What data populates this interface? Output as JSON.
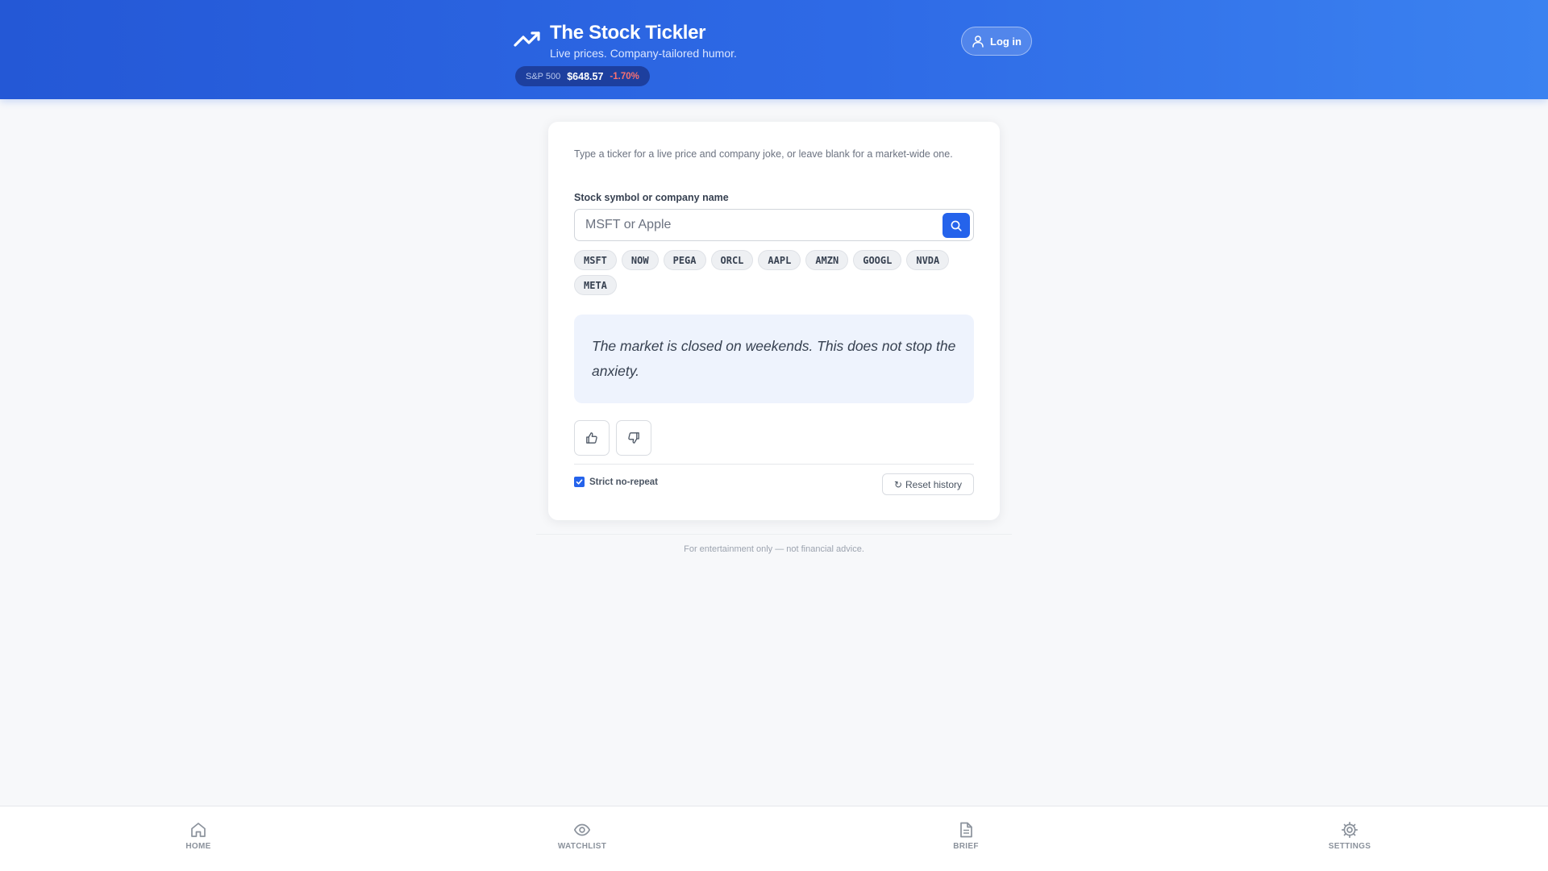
{
  "header": {
    "title": "The Stock Tickler",
    "subtitle": "Live prices. Company-tailored humor.",
    "index": {
      "name": "S&P 500",
      "price": "$648.57",
      "change": "-1.70%"
    },
    "login_label": "Log in"
  },
  "card": {
    "intro": "Type a ticker for a live price and company joke, or leave blank for a market-wide one.",
    "field_label": "Stock symbol or company name",
    "search": {
      "value": "",
      "placeholder": "MSFT or Apple"
    },
    "chips": [
      "MSFT",
      "NOW",
      "PEGA",
      "ORCL",
      "AAPL",
      "AMZN",
      "GOOGL",
      "NVDA",
      "META"
    ],
    "joke": "The market is closed on weekends. This does not stop the anxiety.",
    "strict_label": "Strict no-repeat",
    "strict_checked": true,
    "reset_label": "Reset history"
  },
  "disclaimer": "For entertainment only — not financial advice.",
  "nav": {
    "home": "HOME",
    "watchlist": "WATCHLIST",
    "brief": "BRIEF",
    "settings": "SETTINGS"
  },
  "colors": {
    "accent": "#2563eb",
    "header_start": "#2458d6",
    "header_end": "#3b82f0",
    "negative": "#f87171",
    "joke_bg": "#eef3fd"
  }
}
